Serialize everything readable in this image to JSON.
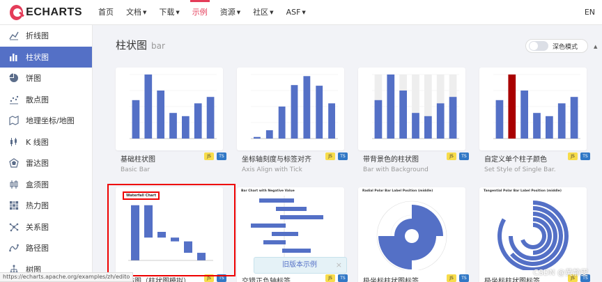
{
  "header": {
    "logo_text": "ECHARTS",
    "nav": [
      {
        "label": "首页",
        "dropdown": false,
        "active": false
      },
      {
        "label": "文档",
        "dropdown": true,
        "active": false
      },
      {
        "label": "下载",
        "dropdown": true,
        "active": false
      },
      {
        "label": "示例",
        "dropdown": false,
        "active": true
      },
      {
        "label": "资源",
        "dropdown": true,
        "active": false
      },
      {
        "label": "社区",
        "dropdown": true,
        "active": false
      },
      {
        "label": "ASF",
        "dropdown": true,
        "active": false
      }
    ],
    "lang": "EN"
  },
  "sidebar": {
    "items": [
      {
        "label": "折线图",
        "icon": "line-chart-icon",
        "active": false
      },
      {
        "label": "柱状图",
        "icon": "bar-chart-icon",
        "active": true
      },
      {
        "label": "饼图",
        "icon": "pie-chart-icon",
        "active": false
      },
      {
        "label": "散点图",
        "icon": "scatter-chart-icon",
        "active": false
      },
      {
        "label": "地理坐标/地图",
        "icon": "map-icon",
        "active": false
      },
      {
        "label": "K 线图",
        "icon": "candlestick-icon",
        "active": false
      },
      {
        "label": "雷达图",
        "icon": "radar-icon",
        "active": false
      },
      {
        "label": "盒须图",
        "icon": "boxplot-icon",
        "active": false
      },
      {
        "label": "热力图",
        "icon": "heatmap-icon",
        "active": false
      },
      {
        "label": "关系图",
        "icon": "graph-icon",
        "active": false
      },
      {
        "label": "路径图",
        "icon": "lines-icon",
        "active": false
      },
      {
        "label": "树图",
        "icon": "tree-icon",
        "active": false
      }
    ]
  },
  "main": {
    "title": "柱状图",
    "subtitle": "bar",
    "dark_mode_label": "深色模式",
    "cards": [
      {
        "title": "基础柱状图",
        "subtitle": "Basic Bar",
        "variant": "basic"
      },
      {
        "title": "坐标轴刻度与标签对齐",
        "subtitle": "Axis Align with Tick",
        "variant": "tick"
      },
      {
        "title": "带背景色的柱状图",
        "subtitle": "Bar with Background",
        "variant": "background"
      },
      {
        "title": "自定义单个柱子颜色",
        "subtitle": "Set Style of Single Bar.",
        "variant": "single"
      },
      {
        "title": "瀑布图（柱状图模拟）",
        "subtitle": "",
        "variant": "waterfall",
        "thumb_title": "Waterfall Chart"
      },
      {
        "title": "交错正负轴标签",
        "subtitle": "",
        "variant": "negative",
        "thumb_title": "Bar Chart with Negative Value"
      },
      {
        "title": "极坐标柱状图标签",
        "subtitle": "",
        "variant": "radial",
        "thumb_title": "Radial Polar Bar Label Position (middle)"
      },
      {
        "title": "极坐标柱状图标签",
        "subtitle": "",
        "variant": "tangential",
        "thumb_title": "Tangential Polar Bar Label Position (middle)"
      }
    ],
    "badge_js": "JS",
    "badge_ts": "TS"
  },
  "banner": {
    "text": "旧版本示例",
    "close": "×"
  },
  "statusbar": {
    "url": "https://echarts.apache.org/examples/zh/edito"
  },
  "watermark": "CSDN @黄静雯",
  "colors": {
    "accent": "#e43c59",
    "bar": "#5470c6",
    "highlight": "#a90000"
  }
}
